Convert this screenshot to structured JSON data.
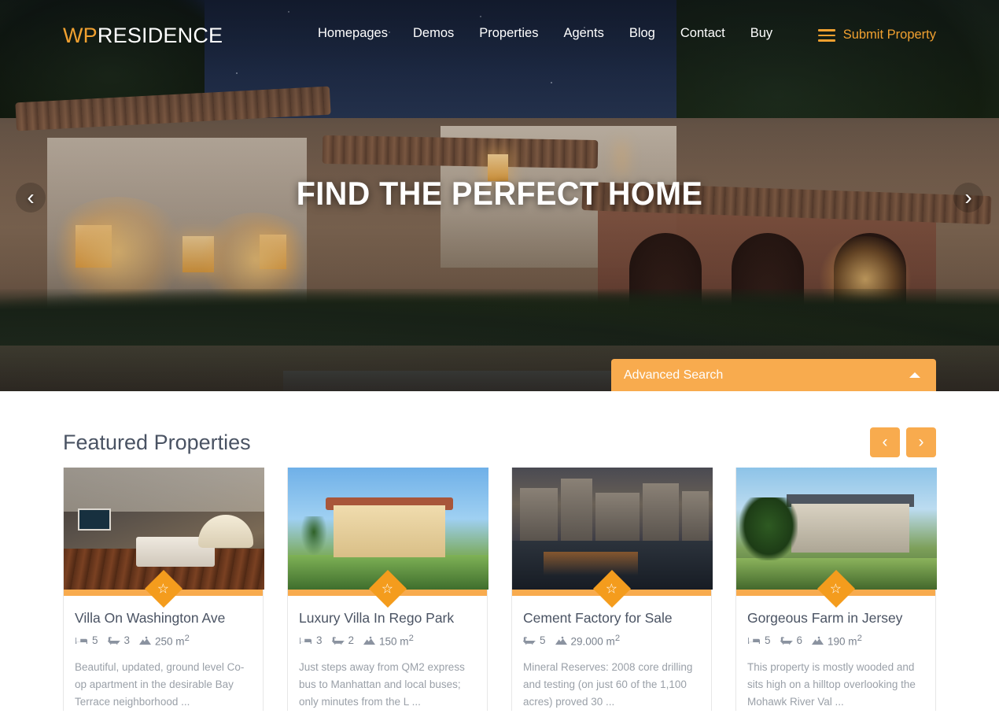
{
  "header": {
    "logo_wp": "WP",
    "logo_rest": "RESIDENCE",
    "nav": [
      {
        "label": "Homepages"
      },
      {
        "label": "Demos"
      },
      {
        "label": "Properties"
      },
      {
        "label": "Agents"
      },
      {
        "label": "Blog"
      },
      {
        "label": "Contact"
      },
      {
        "label": "Buy"
      }
    ],
    "submit_label": "Submit Property",
    "menu_icon": "hamburger-icon",
    "accent_color": "#f0a030"
  },
  "hero": {
    "title": "FIND THE PERFECT HOME",
    "prev_icon": "chevron-left-icon",
    "next_icon": "chevron-right-icon",
    "advanced_search": {
      "label": "Advanced Search",
      "toggle_icon": "caret-up-icon",
      "color": "#f8ab4e"
    }
  },
  "featured": {
    "title": "Featured Properties",
    "prev_label": "‹",
    "next_label": "›",
    "accent_color": "#f8ab4e",
    "cards": [
      {
        "title": "Villa On Washington Ave",
        "beds": "5",
        "baths": "3",
        "area": "250 m",
        "area_sup": "2",
        "description": "Beautiful, updated, ground level Co-op apartment in the desirable Bay Terrace neighborhood ...",
        "badge_icon": "star-icon",
        "image_alt": "hotel-bedroom-photo"
      },
      {
        "title": "Luxury Villa In Rego Park",
        "beds": "3",
        "baths": "2",
        "area": "150 m",
        "area_sup": "2",
        "description": "Just steps away from QM2 express bus to Manhattan and local buses; only minutes from the L ...",
        "badge_icon": "star-icon",
        "image_alt": "mediterranean-villa-photo"
      },
      {
        "title": "Cement Factory for Sale",
        "beds": null,
        "baths": "5",
        "area": "29.000 m",
        "area_sup": "2",
        "description": "Mineral Reserves: 2008 core drilling and testing (on just 60 of the 1,100 acres) proved 30 ...",
        "badge_icon": "star-icon",
        "image_alt": "waterfront-factory-photo"
      },
      {
        "title": "Gorgeous Farm in Jersey",
        "beds": "5",
        "baths": "6",
        "area": "190 m",
        "area_sup": "2",
        "description": "This property is mostly wooded and sits high on a hilltop overlooking the Mohawk River Val ...",
        "badge_icon": "star-icon",
        "image_alt": "country-manor-photo"
      }
    ]
  }
}
